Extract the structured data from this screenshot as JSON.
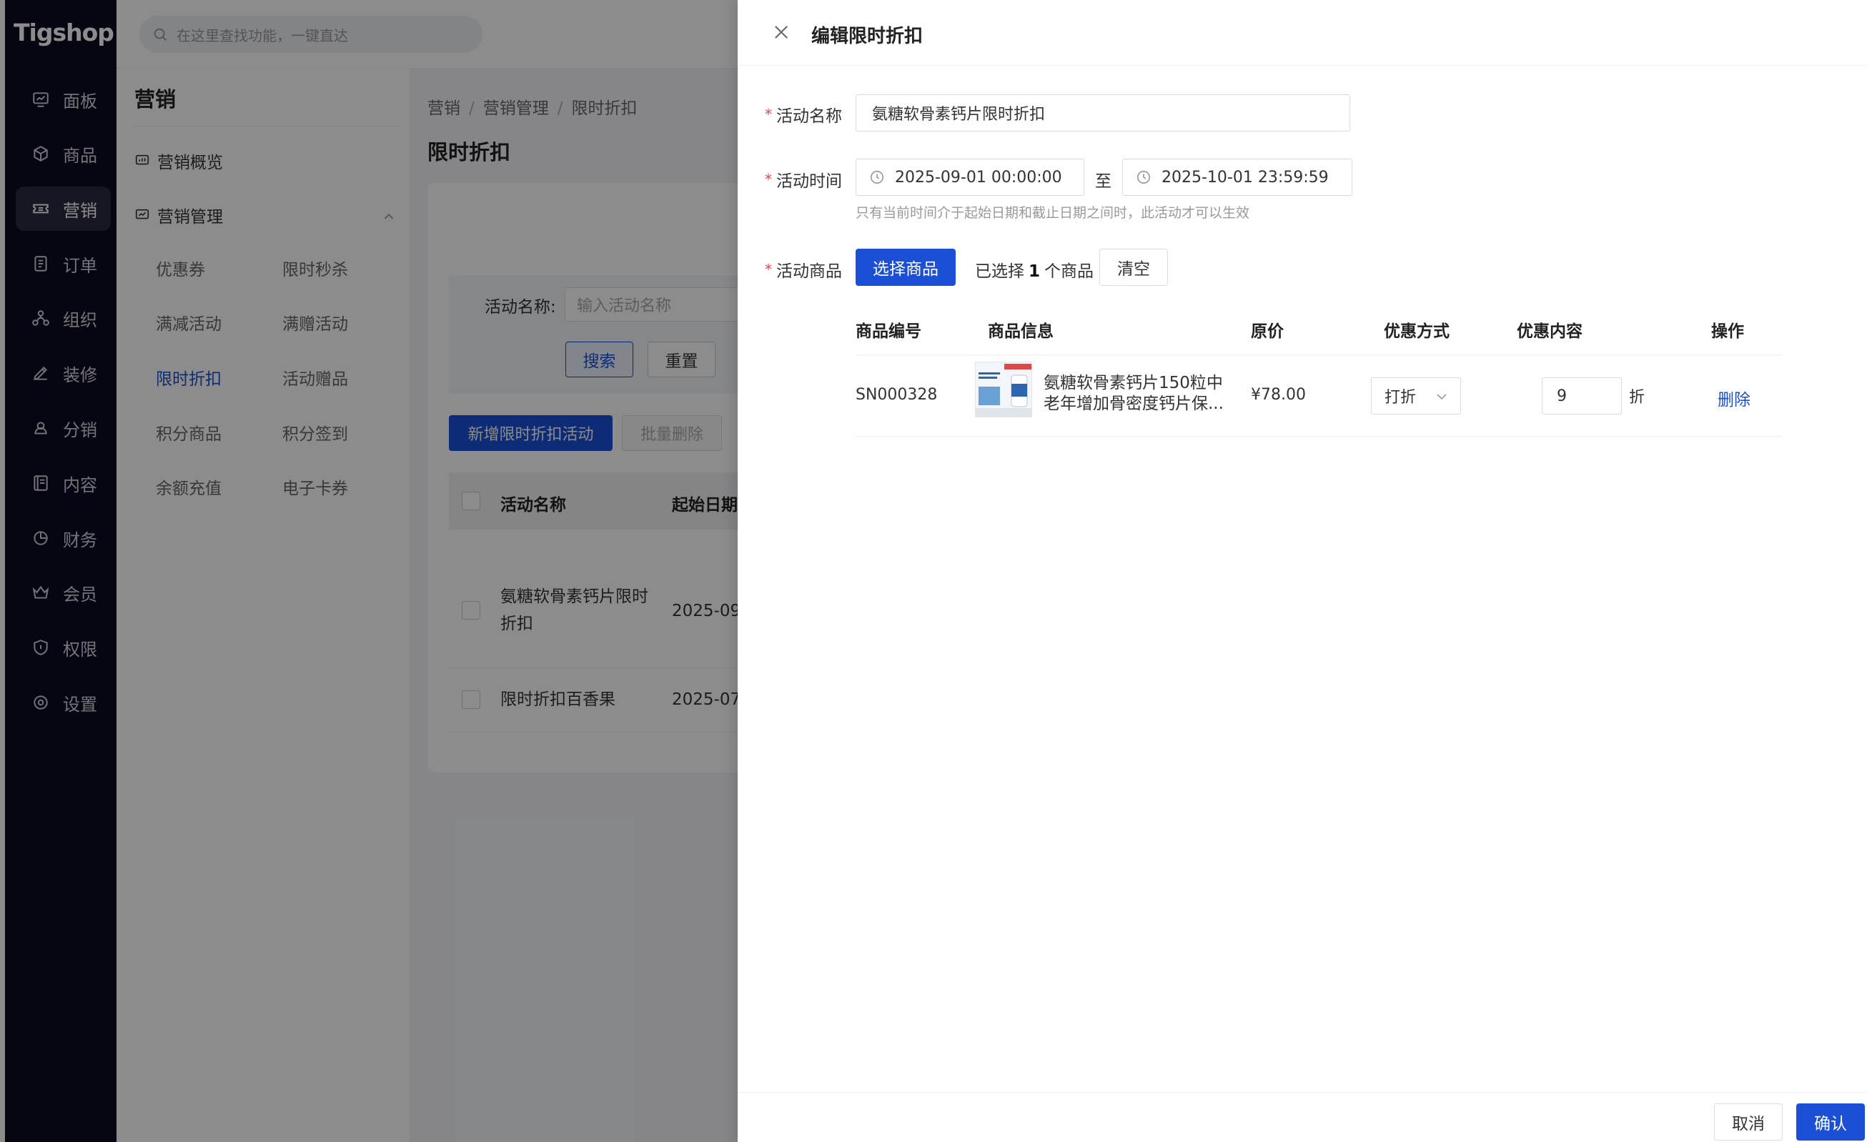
{
  "app": {
    "logo": "Tigshop",
    "search_placeholder": "在这里查找功能，一键直达"
  },
  "sidebar": {
    "items": [
      {
        "label": "面板",
        "icon": "dashboard-icon"
      },
      {
        "label": "商品",
        "icon": "cube-icon"
      },
      {
        "label": "营销",
        "icon": "ticket-icon"
      },
      {
        "label": "订单",
        "icon": "order-icon"
      },
      {
        "label": "组织",
        "icon": "org-icon"
      },
      {
        "label": "装修",
        "icon": "brush-icon"
      },
      {
        "label": "分销",
        "icon": "share-icon"
      },
      {
        "label": "内容",
        "icon": "content-icon"
      },
      {
        "label": "财务",
        "icon": "pie-icon"
      },
      {
        "label": "会员",
        "icon": "crown-icon"
      },
      {
        "label": "权限",
        "icon": "shield-icon"
      },
      {
        "label": "设置",
        "icon": "settings-icon"
      }
    ]
  },
  "subnav": {
    "title": "营销",
    "overview": "营销概览",
    "management": "营销管理",
    "links": [
      "优惠券",
      "限时秒杀",
      "满减活动",
      "满赠活动",
      "限时折扣",
      "活动赠品",
      "积分商品",
      "积分签到",
      "余额充值",
      "电子卡券"
    ]
  },
  "content": {
    "breadcrumb": [
      "营销",
      "营销管理",
      "限时折扣"
    ],
    "page_title": "限时折扣",
    "filter_label": "活动名称:",
    "filter_placeholder": "输入活动名称",
    "search_btn": "搜索",
    "reset_btn": "重置",
    "add_btn": "新增限时折扣活动",
    "batch_delete_btn": "批量删除",
    "columns": [
      "活动名称",
      "起始日期"
    ],
    "rows": [
      {
        "name_line1": "氨糖软骨素钙片限时",
        "name_line2": "折扣",
        "start": "2025-09"
      },
      {
        "name_line1": "限时折扣百香果",
        "name_line2": "",
        "start": "2025-07"
      }
    ]
  },
  "drawer": {
    "title": "编辑限时折扣",
    "name_label": "活动名称",
    "name_value": "氨糖软骨素钙片限时折扣",
    "time_label": "活动时间",
    "start_time": "2025-09-01 00:00:00",
    "to_text": "至",
    "end_time": "2025-10-01 23:59:59",
    "time_hint": "只有当前时间介于起始日期和截止日期之间时，此活动才可以生效",
    "goods_label": "活动商品",
    "select_goods_btn": "选择商品",
    "selected_prefix": "已选择",
    "selected_count": "1",
    "selected_suffix": "个商品",
    "clear_btn": "清空",
    "product_columns": [
      "商品编号",
      "商品信息",
      "原价",
      "优惠方式",
      "优惠内容",
      "操作"
    ],
    "product": {
      "sn": "SN000328",
      "name": "氨糖软骨素钙片150粒中老年增加骨密度钙片保...",
      "price": "¥78.00",
      "discount_type": "打折",
      "discount_value": "9",
      "discount_unit": "折",
      "action": "删除"
    },
    "cancel_btn": "取消",
    "confirm_btn": "确认"
  },
  "colors": {
    "primary": "#1a4fd6",
    "sidebar_bg": "#0c0c22",
    "required": "#f04444"
  }
}
